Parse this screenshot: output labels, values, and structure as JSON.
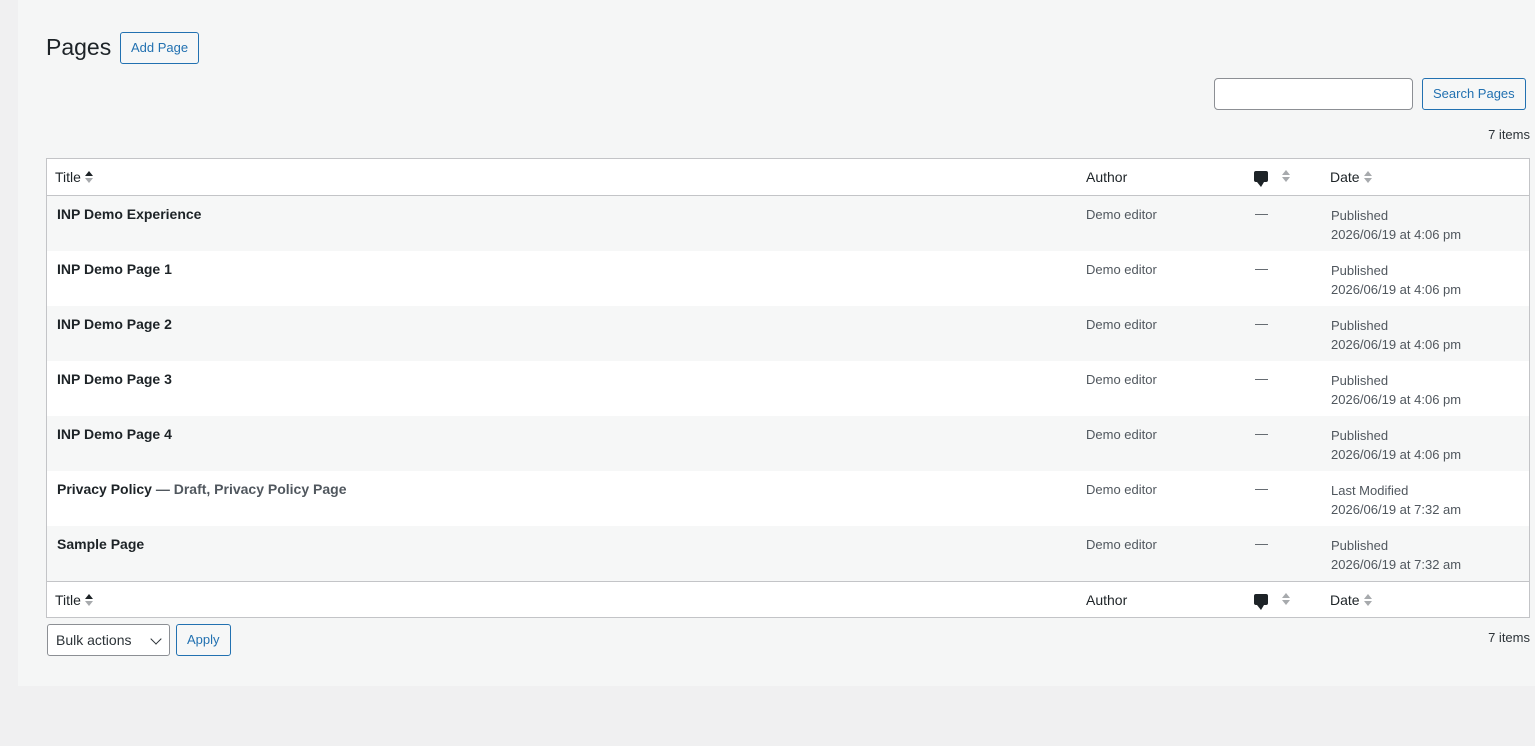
{
  "header": {
    "title": "Pages",
    "add_label": "Add Page"
  },
  "search": {
    "button_label": "Search Pages",
    "value": ""
  },
  "count_label": "7 items",
  "columns": {
    "title": "Title",
    "author": "Author",
    "date": "Date"
  },
  "icons": {
    "comments": "comment-bubble-icon",
    "sort": "sort-arrows-icon",
    "dropdown": "chevron-down-icon"
  },
  "rows": [
    {
      "title": "INP Demo Experience",
      "state": "",
      "author": "Demo editor",
      "comments": "—",
      "status": "Published",
      "date": "2026/06/19 at 4:06 pm"
    },
    {
      "title": "INP Demo Page 1",
      "state": "",
      "author": "Demo editor",
      "comments": "—",
      "status": "Published",
      "date": "2026/06/19 at 4:06 pm"
    },
    {
      "title": "INP Demo Page 2",
      "state": "",
      "author": "Demo editor",
      "comments": "—",
      "status": "Published",
      "date": "2026/06/19 at 4:06 pm"
    },
    {
      "title": "INP Demo Page 3",
      "state": "",
      "author": "Demo editor",
      "comments": "—",
      "status": "Published",
      "date": "2026/06/19 at 4:06 pm"
    },
    {
      "title": "INP Demo Page 4",
      "state": "",
      "author": "Demo editor",
      "comments": "—",
      "status": "Published",
      "date": "2026/06/19 at 4:06 pm"
    },
    {
      "title": "Privacy Policy",
      "state": " — Draft, Privacy Policy Page",
      "author": "Demo editor",
      "comments": "—",
      "status": "Last Modified",
      "date": "2026/06/19 at 7:32 am"
    },
    {
      "title": "Sample Page",
      "state": "",
      "author": "Demo editor",
      "comments": "—",
      "status": "Published",
      "date": "2026/06/19 at 7:32 am"
    }
  ],
  "bulk": {
    "selected": "Bulk actions",
    "apply_label": "Apply"
  },
  "colors": {
    "accent": "#2271b1",
    "text": "#1d2327",
    "muted": "#50575e",
    "border": "#c3c4c7"
  }
}
